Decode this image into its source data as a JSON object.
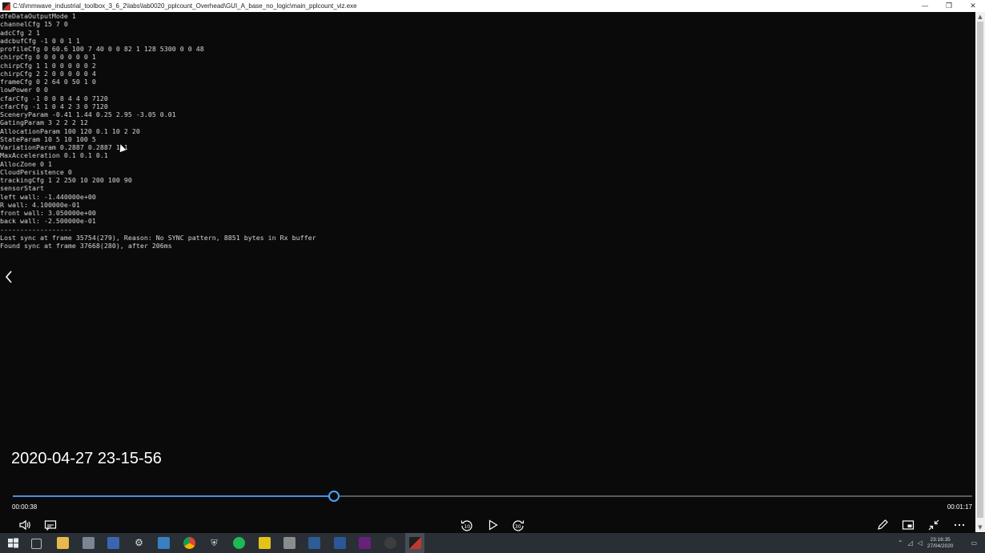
{
  "window": {
    "title": "C:\\ti\\mmwave_industrial_toolbox_3_6_2\\labs\\lab0020_pplcount_Overhead\\GUI_A_base_no_logic\\main_pplcount_viz.exe",
    "minimize": "—",
    "restore": "❐",
    "close": "✕"
  },
  "console": {
    "lines": [
      "dfeDataOutputMode 1",
      "channelCfg 15 7 0",
      "adcCfg 2 1",
      "adcbufCfg -1 0 0 1 1",
      "profileCfg 0 60.6 100 7 40 0 0 82 1 128 5300 0 0 48",
      "chirpCfg 0 0 0 0 0 0 0 1",
      "chirpCfg 1 1 0 0 0 0 0 2",
      "chirpCfg 2 2 0 0 0 0 0 4",
      "frameCfg 0 2 64 0 50 1 0",
      "lowPower 0 0",
      "cfarCfg -1 0 0 8 4 4 0 7120",
      "cfarCfg -1 1 0 4 2 3 0 7120",
      "SceneryParam -0.41 1.44 0.25 2.95 -3.05 0.01",
      "GatingParam 3 2 2 2 12",
      "AllocationParam 100 120 0.1 10 2 20",
      "StateParam 10 5 10 100 5",
      "VariationParam 0.2887 0.2887 1 1",
      "MaxAcceleration 0.1 0.1 0.1",
      "AllocZone 0 1",
      "CloudPersistence 0",
      "trackingCfg 1 2 250 10 200 100 90",
      "sensorStart",
      "left wall: -1.440000e+00",
      "R wall: 4.100000e-01",
      "front wall: 3.050000e+00",
      "back wall: -2.500000e-01",
      "------------------",
      "Lost sync at frame 35754(279), Reason: No SYNC pattern, 8851 bytes in Rx buffer",
      "Found sync at frame 37668(280), after 206ms"
    ]
  },
  "player": {
    "timestamp": "2020-04-27 23-15-56",
    "current_time": "00:00:38",
    "total_time": "00:01:17",
    "progress_fraction": 0.3347,
    "skip_back_label": "10",
    "skip_forward_label": "30"
  },
  "taskbar": {
    "clock_time": "23:16:35",
    "clock_date": "27/04/2020"
  },
  "colors": {
    "accent": "#4aa3ff",
    "console_text": "#d6d6d6",
    "background": "#0a0a0a",
    "taskbar": "#2a2f36"
  }
}
